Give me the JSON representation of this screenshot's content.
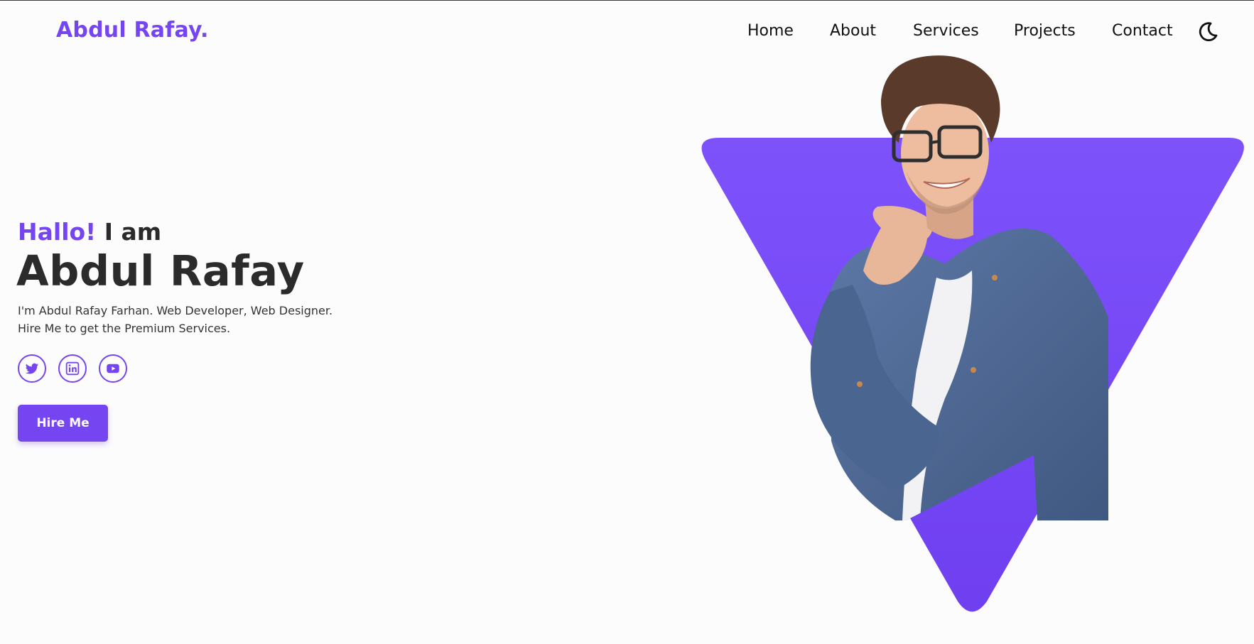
{
  "header": {
    "logo": "Abdul Rafay.",
    "nav": [
      "Home",
      "About",
      "Services",
      "Projects",
      "Contact"
    ],
    "theme_toggle_icon": "moon-icon"
  },
  "hero": {
    "greeting_accent": "Hallo!",
    "greeting_rest": " I am",
    "name": "Abdul Rafay",
    "description_line1": "I'm Abdul Rafay Farhan. Web Developer, Web Designer.",
    "description_line2": "Hire Me to get the Premium Services.",
    "socials": [
      {
        "icon": "twitter-icon"
      },
      {
        "icon": "linkedin-icon"
      },
      {
        "icon": "youtube-icon"
      }
    ],
    "cta_label": "Hire Me"
  },
  "colors": {
    "accent": "#7645f2",
    "text": "#2b2b2b",
    "background": "#fdfcfd"
  }
}
